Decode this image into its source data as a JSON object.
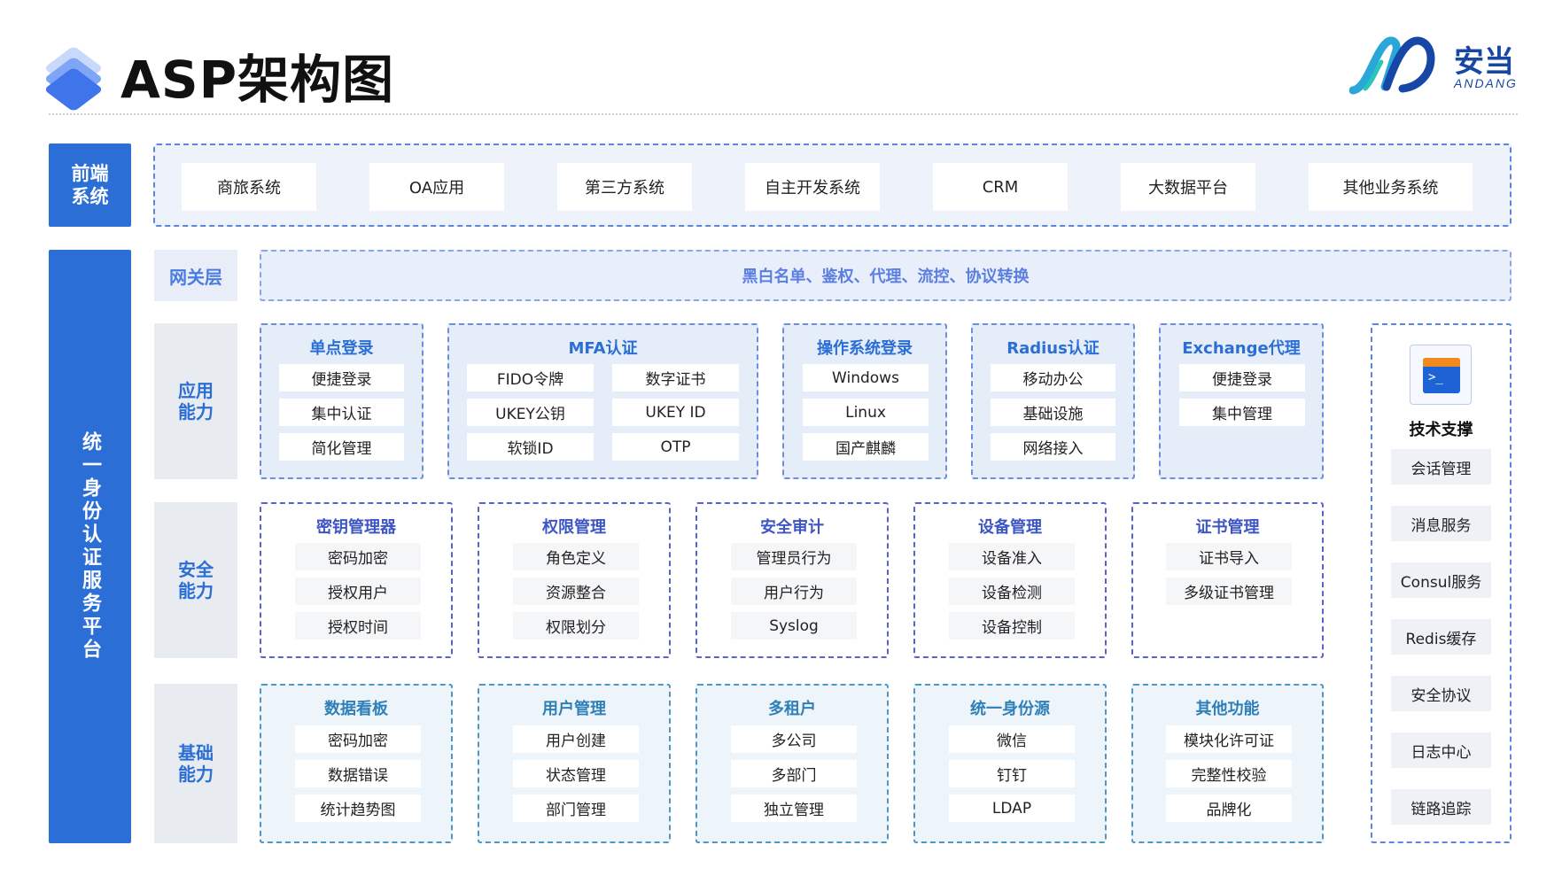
{
  "header": {
    "title": "ASP架构图",
    "brand_cn": "安当",
    "brand_en": "ANDANG"
  },
  "frontend": {
    "tag": "前端系统",
    "items": [
      "商旅系统",
      "OA应用",
      "第三方系统",
      "自主开发系统",
      "CRM",
      "大数据平台",
      "其他业务系统"
    ]
  },
  "platform": {
    "tag": "统一身份认证服务平台"
  },
  "gateway": {
    "tag": "网关层",
    "content": "黑白名单、鉴权、代理、流控、协议转换"
  },
  "app_layer": {
    "tag": "应用能力",
    "groups": [
      {
        "title": "单点登录",
        "items": [
          "便捷登录",
          "集中认证",
          "简化管理"
        ]
      },
      {
        "title": "MFA认证",
        "items": [
          "FIDO令牌",
          "数字证书",
          "UKEY公钥",
          "UKEY ID",
          "软锁ID",
          "OTP"
        ]
      },
      {
        "title": "操作系统登录",
        "items": [
          "Windows",
          "Linux",
          "国产麒麟"
        ]
      },
      {
        "title": "Radius认证",
        "items": [
          "移动办公",
          "基础设施",
          "网络接入"
        ]
      },
      {
        "title": "Exchange代理",
        "items": [
          "便捷登录",
          "集中管理"
        ]
      }
    ]
  },
  "security_layer": {
    "tag": "安全能力",
    "groups": [
      {
        "title": "密钥管理器",
        "items": [
          "密码加密",
          "授权用户",
          "授权时间"
        ]
      },
      {
        "title": "权限管理",
        "items": [
          "角色定义",
          "资源整合",
          "权限划分"
        ]
      },
      {
        "title": "安全审计",
        "items": [
          "管理员行为",
          "用户行为",
          "Syslog"
        ]
      },
      {
        "title": "设备管理",
        "items": [
          "设备准入",
          "设备检测",
          "设备控制"
        ]
      },
      {
        "title": "证书管理",
        "items": [
          "证书导入",
          "多级证书管理"
        ]
      }
    ]
  },
  "base_layer": {
    "tag": "基础能力",
    "groups": [
      {
        "title": "数据看板",
        "items": [
          "密码加密",
          "数据错误",
          "统计趋势图"
        ]
      },
      {
        "title": "用户管理",
        "items": [
          "用户创建",
          "状态管理",
          "部门管理"
        ]
      },
      {
        "title": "多租户",
        "items": [
          "多公司",
          "多部门",
          "独立管理"
        ]
      },
      {
        "title": "统一身份源",
        "items": [
          "微信",
          "钉钉",
          "LDAP"
        ]
      },
      {
        "title": "其他功能",
        "items": [
          "模块化许可证",
          "完整性校验",
          "品牌化"
        ]
      }
    ]
  },
  "support": {
    "title": "技术支撑",
    "icon": "terminal-icon",
    "items": [
      "会话管理",
      "消息服务",
      "Consul服务",
      "Redis缓存",
      "安全协议",
      "日志中心",
      "链路追踪"
    ]
  }
}
